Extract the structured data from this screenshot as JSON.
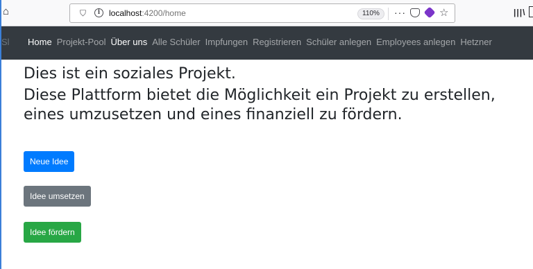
{
  "browser": {
    "url_host": "localhost",
    "url_path": ":4200/home",
    "zoom": "110%",
    "icons": [
      "home-icon",
      "shield-icon",
      "info-icon",
      "more-icon",
      "pocket-icon",
      "extension-icon",
      "star-icon",
      "library-icon",
      "sidebar-icon"
    ]
  },
  "navbar": {
    "brand": "Sl",
    "links": [
      {
        "label": "Home",
        "active": true
      },
      {
        "label": "Projekt-Pool",
        "active": false
      },
      {
        "label": "Über uns",
        "active": true
      },
      {
        "label": "Alle Schüler",
        "active": false
      },
      {
        "label": "Impfungen",
        "active": false
      },
      {
        "label": "Registrieren",
        "active": false
      },
      {
        "label": "Schüler anlegen",
        "active": false
      },
      {
        "label": "Employees anlegen",
        "active": false
      },
      {
        "label": "Hetzner",
        "active": false
      }
    ]
  },
  "main": {
    "line1": "Dies ist ein soziales Projekt.",
    "line2": "Diese Plattform bietet die Möglichkeit ein Projekt zu erstellen,",
    "line3": "eines umzusetzen und eines finanziell zu fördern.",
    "buttons": {
      "new_idea": "Neue Idee",
      "implement": "Idee umsetzen",
      "fund": "Idee fördern"
    }
  },
  "colors": {
    "navbar_bg": "#343a40",
    "primary": "#007bff",
    "secondary": "#6c757d",
    "success": "#28a745"
  }
}
